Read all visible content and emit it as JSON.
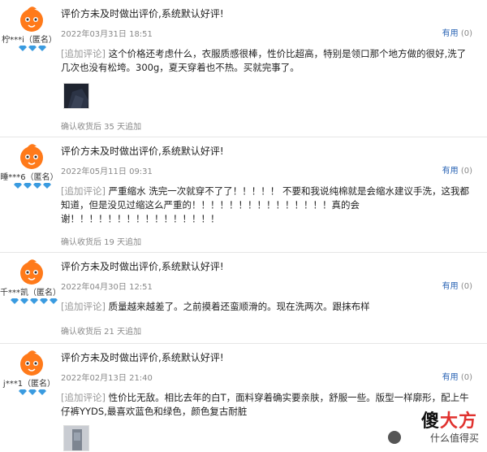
{
  "reviews": [
    {
      "username": "柠***i（匿名）",
      "gem_count": 3,
      "title": "评价方未及时做出评价,系统默认好评!",
      "date": "2022年03月31日 18:51",
      "helpful_label": "有用",
      "helpful_count": "(0)",
      "followup_tag": "[追加评论]",
      "followup_text": "这个价格还考虑什么，衣服质感很棒，性价比超高，特别是领口那个地方做的很好,洗了几次也没有松垮。300g，夏天穿着也不热。买就完事了。",
      "has_photo": true,
      "confirm": "确认收货后 35 天追加"
    },
    {
      "username": "睡***6（匿名）",
      "gem_count": 4,
      "title": "评价方未及时做出评价,系统默认好评!",
      "date": "2022年05月11日 09:31",
      "helpful_label": "有用",
      "helpful_count": "(0)",
      "followup_tag": "[追加评论]",
      "followup_text": "严重缩水 洗完一次就穿不了了！！！！！ 不要和我说纯棉就是会缩水建议手洗，这我都知道，但是没见过缩这么严重的！！！！！！！！！！！！！！！真的会谢！！！！！！！！！！！！！！！！",
      "has_photo": false,
      "confirm": "确认收货后 19 天追加"
    },
    {
      "username": "千***凯（匿名）",
      "gem_count": 5,
      "title": "评价方未及时做出评价,系统默认好评!",
      "date": "2022年04月30日 12:51",
      "helpful_label": "有用",
      "helpful_count": "(0)",
      "followup_tag": "[追加评论]",
      "followup_text": "质量越来越差了。之前摸着还蛮顺滑的。现在洗两次。跟抹布样",
      "has_photo": false,
      "confirm": "确认收货后 21 天追加"
    },
    {
      "username": "j***1（匿名）",
      "gem_count": 3,
      "title": "评价方未及时做出评价,系统默认好评!",
      "date": "2022年02月13日 21:40",
      "helpful_label": "有用",
      "helpful_count": "(0)",
      "followup_tag": "[追加评论]",
      "followup_text": "性价比无敌。相比去年的白T，面料穿着确实要亲肤，舒服一些。版型一样廓形，配上牛仔裤YYDS,最喜欢蓝色和绿色，颜色复古耐脏",
      "has_photo": true,
      "confirm": ""
    }
  ],
  "watermark": {
    "main_black": "傻",
    "main_red": "大方",
    "sub": "什么值得买"
  },
  "icons": {
    "avatar": "orange-mascot-avatar-icon",
    "gem": "blue-diamond-gem-icon"
  },
  "colors": {
    "useful_link": "#2a64b4",
    "gem": "#3a9be0",
    "avatar": "#ff7a1a"
  }
}
